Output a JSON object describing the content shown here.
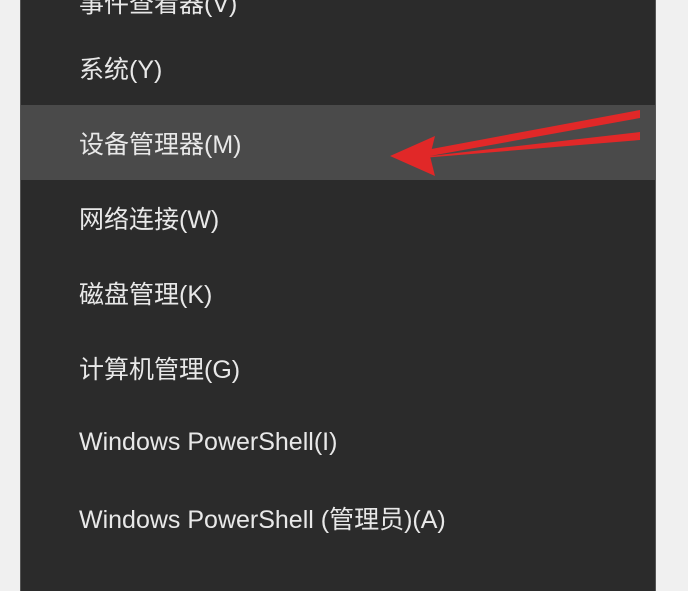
{
  "menu": {
    "items": [
      {
        "label": "事件查看器(V)",
        "highlighted": false,
        "partial": true
      },
      {
        "label": "系统(Y)",
        "highlighted": false
      },
      {
        "label": "设备管理器(M)",
        "highlighted": true
      },
      {
        "label": "网络连接(W)",
        "highlighted": false
      },
      {
        "label": "磁盘管理(K)",
        "highlighted": false
      },
      {
        "label": "计算机管理(G)",
        "highlighted": false
      },
      {
        "label": "Windows PowerShell(I)",
        "highlighted": false
      },
      {
        "label": "Windows PowerShell (管理员)(A)",
        "highlighted": false
      }
    ]
  },
  "annotation": {
    "color": "#e12828"
  }
}
